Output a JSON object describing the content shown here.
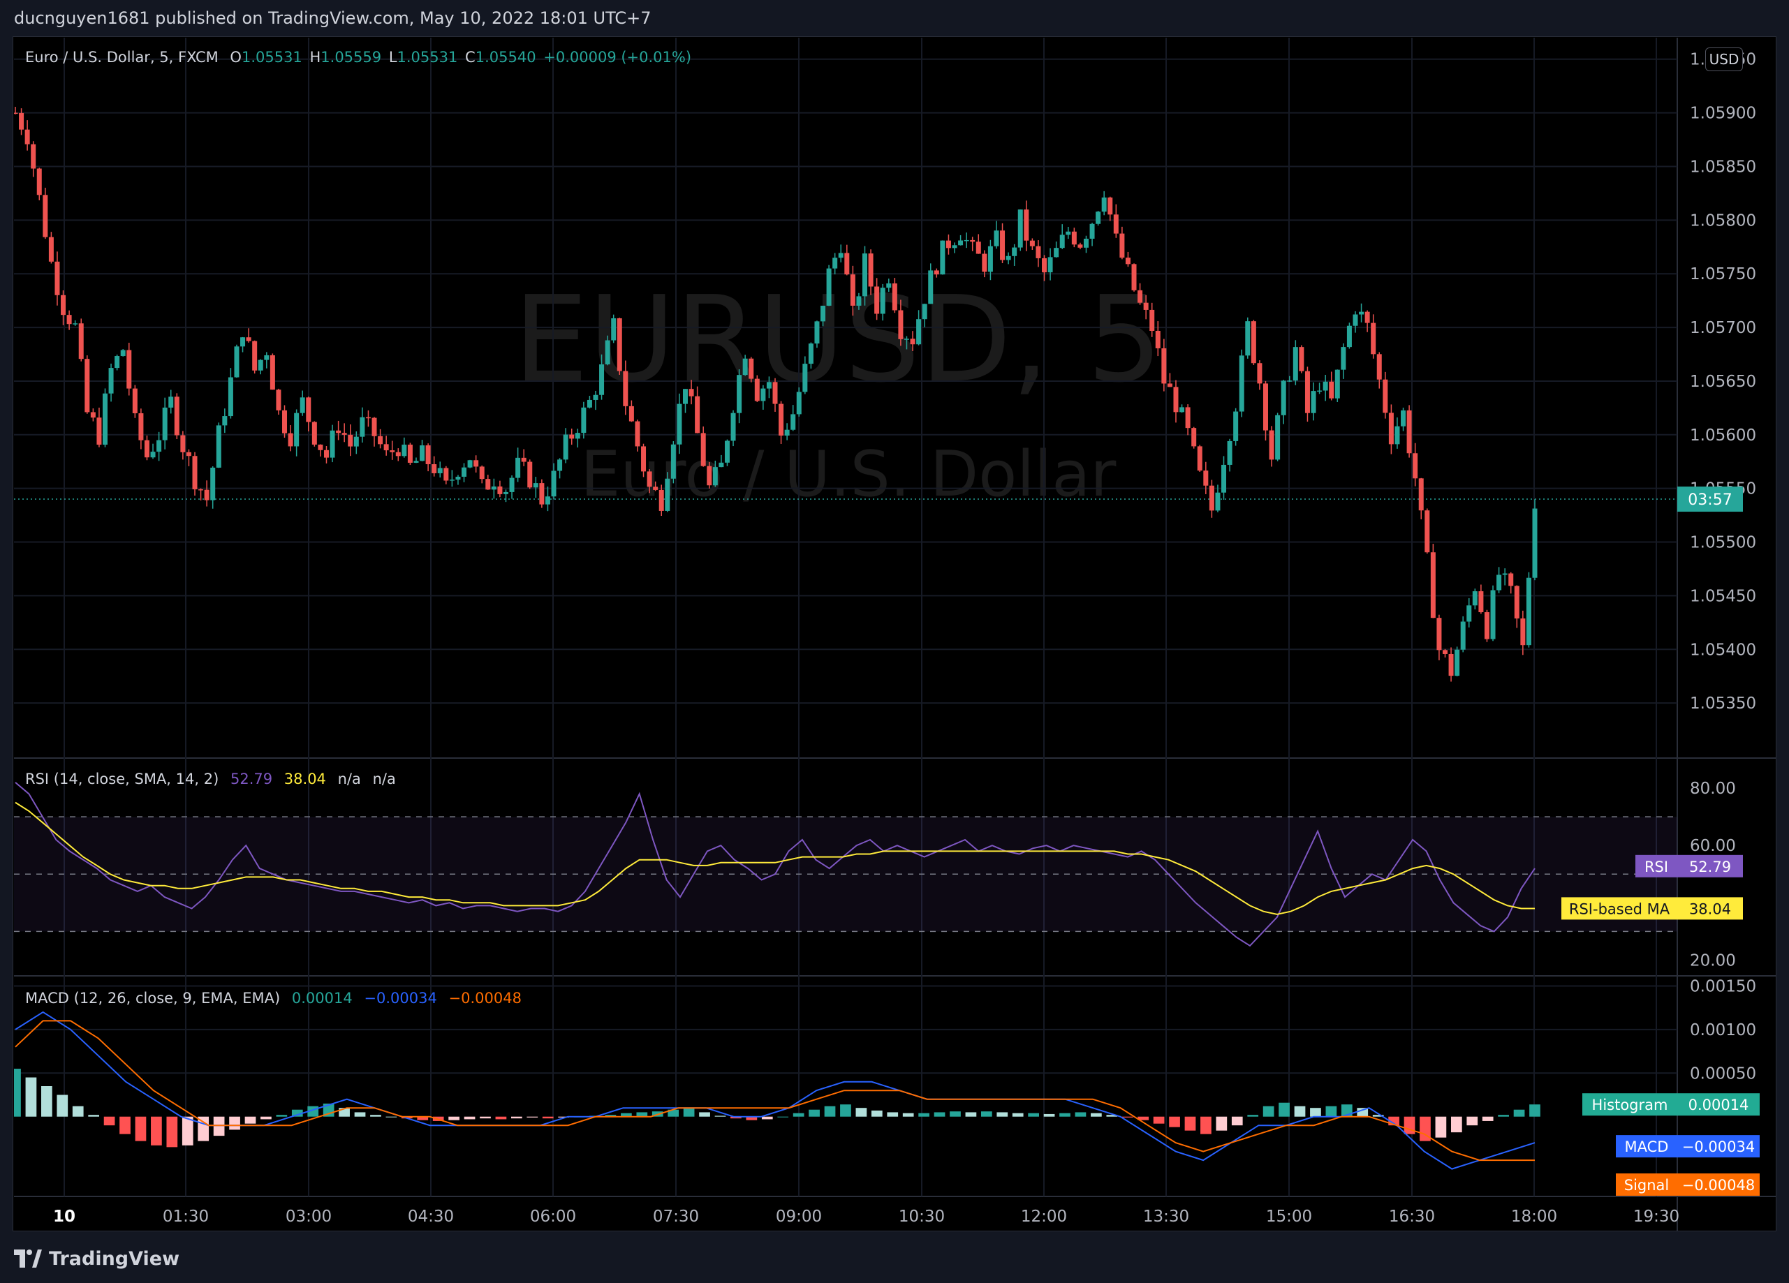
{
  "header": {
    "published_text": "ducnguyen1681 published on TradingView.com, May 10, 2022 18:01 UTC+7"
  },
  "footer": {
    "brand": "TradingView"
  },
  "main_legend": {
    "symbol": "Euro / U.S. Dollar, 5, FXCM",
    "o_label": "O",
    "o_value": "1.05531",
    "h_label": "H",
    "h_value": "1.05559",
    "l_label": "L",
    "l_value": "1.05531",
    "c_label": "C",
    "c_value": "1.05540",
    "change": "+0.00009 (+0.01%)"
  },
  "currency_button": "USD",
  "watermark": {
    "line1": "EURUSD, 5",
    "line2": "Euro / U.S. Dollar"
  },
  "countdown": "03:57",
  "rsi_legend": {
    "name": "RSI (14, close, SMA, 14, 2)",
    "rsi_value": "52.79",
    "ma_value": "38.04",
    "na1": "n/a",
    "na2": "n/a"
  },
  "rsi_tags": {
    "rsi_label": "RSI",
    "rsi_value": "52.79",
    "ma_label": "RSI-based MA",
    "ma_value": "38.04"
  },
  "macd_legend": {
    "name": "MACD (12, 26, close, 9, EMA, EMA)",
    "hist": "0.00014",
    "macd": "−0.00034",
    "signal": "−0.00048"
  },
  "macd_tags": {
    "hist_label": "Histogram",
    "hist_value": "0.00014",
    "macd_label": "MACD",
    "macd_value": "−0.00034",
    "signal_label": "Signal",
    "signal_value": "−0.00048"
  },
  "colors": {
    "up": "#26a69a",
    "down": "#ef5350",
    "rsi": "#7e57c2",
    "rsi_ma": "#ffeb3b",
    "macd": "#2962ff",
    "signal": "#ff6d00",
    "hist_up_strong": "#26a69a",
    "hist_up_weak": "#b2dfdb",
    "hist_down_strong": "#ff5252",
    "hist_down_weak": "#ffcdd2"
  },
  "chart_data": [
    {
      "type": "candlestick",
      "title": "Euro / U.S. Dollar, 5, FXCM",
      "ylim": [
        1.053,
        1.0597
      ],
      "yticks": [
        "1.05950",
        "1.05900",
        "1.05850",
        "1.05800",
        "1.05750",
        "1.05700",
        "1.05650",
        "1.05600",
        "1.05550",
        "1.05500",
        "1.05450",
        "1.05400",
        "1.05350"
      ],
      "xticks": [
        "10",
        "01:30",
        "03:00",
        "04:30",
        "06:00",
        "07:30",
        "09:00",
        "10:30",
        "12:00",
        "13:30",
        "15:00",
        "16:30",
        "18:00",
        "19:30"
      ],
      "last_close": 1.0554,
      "close_path": [
        [
          0,
          1.059
        ],
        [
          2,
          1.0588
        ],
        [
          4,
          1.0582
        ],
        [
          6,
          1.0576
        ],
        [
          8,
          1.0572
        ],
        [
          10,
          1.057
        ],
        [
          12,
          1.0562
        ],
        [
          14,
          1.056
        ],
        [
          16,
          1.0566
        ],
        [
          18,
          1.0568
        ],
        [
          20,
          1.0561
        ],
        [
          22,
          1.0558
        ],
        [
          24,
          1.056
        ],
        [
          26,
          1.0563
        ],
        [
          28,
          1.0559
        ],
        [
          30,
          1.0556
        ],
        [
          32,
          1.0554
        ],
        [
          34,
          1.056
        ],
        [
          36,
          1.0565
        ],
        [
          38,
          1.057
        ],
        [
          40,
          1.0566
        ],
        [
          42,
          1.0568
        ],
        [
          44,
          1.0562
        ],
        [
          46,
          1.056
        ],
        [
          48,
          1.0563
        ],
        [
          50,
          1.056
        ],
        [
          52,
          1.0558
        ],
        [
          54,
          1.0561
        ],
        [
          56,
          1.0559
        ],
        [
          58,
          1.0561
        ],
        [
          60,
          1.056
        ],
        [
          62,
          1.0558
        ],
        [
          64,
          1.0559
        ],
        [
          66,
          1.0557
        ],
        [
          68,
          1.0558
        ],
        [
          70,
          1.0557
        ],
        [
          72,
          1.0555
        ],
        [
          74,
          1.0557
        ],
        [
          76,
          1.0558
        ],
        [
          78,
          1.0555
        ],
        [
          80,
          1.0556
        ],
        [
          82,
          1.0555
        ],
        [
          84,
          1.0557
        ],
        [
          86,
          1.0556
        ],
        [
          88,
          1.0554
        ],
        [
          90,
          1.0556
        ],
        [
          92,
          1.0559
        ],
        [
          94,
          1.0561
        ],
        [
          96,
          1.0563
        ],
        [
          98,
          1.0566
        ],
        [
          100,
          1.057
        ],
        [
          102,
          1.0563
        ],
        [
          104,
          1.0559
        ],
        [
          106,
          1.0555
        ],
        [
          108,
          1.0554
        ],
        [
          110,
          1.056
        ],
        [
          112,
          1.0565
        ],
        [
          114,
          1.056
        ],
        [
          116,
          1.0555
        ],
        [
          118,
          1.0557
        ],
        [
          120,
          1.0563
        ],
        [
          122,
          1.0568
        ],
        [
          124,
          1.0564
        ],
        [
          126,
          1.0565
        ],
        [
          128,
          1.056
        ],
        [
          130,
          1.0562
        ],
        [
          132,
          1.0566
        ],
        [
          134,
          1.057
        ],
        [
          136,
          1.0575
        ],
        [
          138,
          1.0578
        ],
        [
          140,
          1.0571
        ],
        [
          142,
          1.0576
        ],
        [
          144,
          1.0572
        ],
        [
          146,
          1.0575
        ],
        [
          148,
          1.057
        ],
        [
          150,
          1.0569
        ],
        [
          152,
          1.0573
        ],
        [
          154,
          1.0576
        ],
        [
          156,
          1.0578
        ],
        [
          158,
          1.0579
        ],
        [
          160,
          1.0577
        ],
        [
          162,
          1.0576
        ],
        [
          164,
          1.0578
        ],
        [
          166,
          1.0576
        ],
        [
          168,
          1.058
        ],
        [
          170,
          1.0577
        ],
        [
          172,
          1.0575
        ],
        [
          174,
          1.0577
        ],
        [
          176,
          1.0579
        ],
        [
          178,
          1.0578
        ],
        [
          180,
          1.058
        ],
        [
          182,
          1.0583
        ],
        [
          184,
          1.0578
        ],
        [
          186,
          1.0575
        ],
        [
          188,
          1.0572
        ],
        [
          190,
          1.057
        ],
        [
          192,
          1.0565
        ],
        [
          194,
          1.0563
        ],
        [
          196,
          1.056
        ],
        [
          198,
          1.0556
        ],
        [
          200,
          1.0553
        ],
        [
          202,
          1.0558
        ],
        [
          204,
          1.0563
        ],
        [
          206,
          1.057
        ],
        [
          208,
          1.0565
        ],
        [
          210,
          1.0558
        ],
        [
          212,
          1.0564
        ],
        [
          214,
          1.0568
        ],
        [
          216,
          1.0562
        ],
        [
          218,
          1.0565
        ],
        [
          220,
          1.0563
        ],
        [
          222,
          1.0568
        ],
        [
          224,
          1.0572
        ],
        [
          226,
          1.057
        ],
        [
          228,
          1.0565
        ],
        [
          230,
          1.056
        ],
        [
          232,
          1.0562
        ],
        [
          234,
          1.0556
        ],
        [
          236,
          1.0548
        ],
        [
          238,
          1.054
        ],
        [
          240,
          1.0538
        ],
        [
          242,
          1.0542
        ],
        [
          244,
          1.0546
        ],
        [
          246,
          1.0542
        ],
        [
          248,
          1.0547
        ],
        [
          250,
          1.0545
        ],
        [
          252,
          1.054
        ],
        [
          254,
          1.0554
        ]
      ]
    },
    {
      "type": "line",
      "title": "RSI (14, close, SMA, 14, 2)",
      "ylim": [
        15,
        90
      ],
      "yticks": [
        "80.00",
        "60.00",
        "20.00"
      ],
      "bands": [
        70,
        50,
        30
      ],
      "series": [
        {
          "name": "RSI",
          "values": [
            82,
            78,
            70,
            62,
            58,
            55,
            52,
            48,
            46,
            44,
            46,
            42,
            40,
            38,
            42,
            48,
            55,
            60,
            52,
            50,
            48,
            47,
            46,
            45,
            44,
            44,
            43,
            42,
            41,
            40,
            41,
            39,
            40,
            38,
            39,
            39,
            38,
            37,
            38,
            38,
            37,
            39,
            44,
            52,
            60,
            68,
            78,
            62,
            48,
            42,
            50,
            58,
            60,
            55,
            52,
            48,
            50,
            58,
            62,
            55,
            52,
            56,
            60,
            62,
            58,
            60,
            58,
            56,
            58,
            60,
            62,
            58,
            60,
            58,
            57,
            59,
            60,
            58,
            60,
            59,
            58,
            57,
            56,
            58,
            55,
            50,
            45,
            40,
            36,
            32,
            28,
            25,
            30,
            35,
            45,
            55,
            65,
            52,
            42,
            46,
            50,
            48,
            55,
            62,
            58,
            48,
            40,
            36,
            32,
            30,
            35,
            45,
            52
          ],
          "color": "#7e57c2"
        },
        {
          "name": "RSI-based MA",
          "values": [
            75,
            72,
            68,
            64,
            60,
            56,
            53,
            50,
            48,
            47,
            46,
            46,
            45,
            45,
            46,
            47,
            48,
            49,
            49,
            49,
            48,
            48,
            47,
            46,
            45,
            45,
            44,
            44,
            43,
            42,
            42,
            41,
            41,
            40,
            40,
            40,
            39,
            39,
            39,
            39,
            39,
            40,
            41,
            44,
            48,
            52,
            55,
            55,
            55,
            54,
            53,
            53,
            54,
            54,
            54,
            54,
            54,
            55,
            56,
            56,
            56,
            56,
            57,
            57,
            58,
            58,
            58,
            58,
            58,
            58,
            58,
            58,
            58,
            58,
            58,
            58,
            58,
            58,
            58,
            58,
            58,
            58,
            57,
            57,
            56,
            55,
            53,
            51,
            48,
            45,
            42,
            39,
            37,
            36,
            37,
            39,
            42,
            44,
            45,
            46,
            47,
            48,
            50,
            52,
            53,
            52,
            50,
            47,
            44,
            41,
            39,
            38,
            38
          ],
          "color": "#ffeb3b"
        }
      ]
    },
    {
      "type": "bar+line",
      "title": "MACD (12, 26, close, 9, EMA, EMA)",
      "ylim": [
        -0.0009,
        0.0016
      ],
      "yticks": [
        "0.00150",
        "0.00100",
        "0.00050"
      ],
      "histogram": [
        0.00055,
        0.00045,
        0.00035,
        0.00025,
        0.00012,
        2e-05,
        -0.0001,
        -0.0002,
        -0.00028,
        -0.00033,
        -0.00035,
        -0.00033,
        -0.00028,
        -0.00022,
        -0.00015,
        -8e-05,
        -3e-05,
        2e-05,
        8e-05,
        0.00012,
        0.00015,
        0.0001,
        5e-05,
        2e-05,
        0,
        -2e-05,
        -4e-05,
        -5e-05,
        -4e-05,
        -3e-05,
        -2e-05,
        -3e-05,
        -2e-05,
        -1e-05,
        -2e-05,
        -1e-05,
        0,
        1e-05,
        2e-05,
        4e-05,
        5e-05,
        6e-05,
        8e-05,
        0.0001,
        5e-05,
        1e-05,
        -2e-05,
        -4e-05,
        -3e-05,
        0,
        4e-05,
        8e-05,
        0.00012,
        0.00014,
        0.0001,
        7e-05,
        5e-05,
        4e-05,
        4e-05,
        5e-05,
        6e-05,
        5e-05,
        6e-05,
        5e-05,
        4e-05,
        4e-05,
        3e-05,
        4e-05,
        5e-05,
        4e-05,
        2e-05,
        -1e-05,
        -4e-05,
        -8e-05,
        -0.00012,
        -0.00016,
        -0.0002,
        -0.00016,
        -0.0001,
        2e-05,
        0.00012,
        0.00016,
        0.00012,
        0.0001,
        0.00012,
        0.00014,
        0.0001,
        2e-05,
        -0.0001,
        -0.0002,
        -0.00028,
        -0.00024,
        -0.00018,
        -0.0001,
        -5e-05,
        2e-05,
        8e-05,
        0.00014
      ],
      "series": [
        {
          "name": "MACD",
          "values": [
            0.001,
            0.0012,
            0.001,
            0.0007,
            0.0004,
            0.0002,
            0.0,
            -0.0001,
            -0.0001,
            -0.0001,
            0.0,
            0.0001,
            0.0002,
            0.0001,
            0.0,
            -0.0001,
            -0.0001,
            -0.0001,
            -0.0001,
            -0.0001,
            0.0,
            0.0,
            0.0001,
            0.0001,
            0.0001,
            0.0001,
            0.0,
            0.0,
            0.0001,
            0.0003,
            0.0004,
            0.0004,
            0.0003,
            0.0002,
            0.0002,
            0.0002,
            0.0002,
            0.0002,
            0.0002,
            0.0001,
            0.0,
            -0.0002,
            -0.0004,
            -0.0005,
            -0.0003,
            -0.0001,
            -0.0001,
            0.0,
            0.0,
            0.0001,
            -0.0001,
            -0.0004,
            -0.0006,
            -0.0005,
            -0.0004,
            -0.0003
          ]
        },
        {
          "name": "Signal",
          "values": [
            0.0008,
            0.0011,
            0.0011,
            0.0009,
            0.0006,
            0.0003,
            0.0001,
            -0.0001,
            -0.0001,
            -0.0001,
            -0.0001,
            0.0,
            0.0001,
            0.0001,
            0.0,
            0.0,
            -0.0001,
            -0.0001,
            -0.0001,
            -0.0001,
            -0.0001,
            0.0,
            0.0,
            0.0,
            0.0001,
            0.0001,
            0.0001,
            0.0001,
            0.0001,
            0.0002,
            0.0003,
            0.0003,
            0.0003,
            0.0002,
            0.0002,
            0.0002,
            0.0002,
            0.0002,
            0.0002,
            0.0002,
            0.0001,
            -0.0001,
            -0.0003,
            -0.0004,
            -0.0003,
            -0.0002,
            -0.0001,
            -0.0001,
            0.0,
            0.0,
            -0.0001,
            -0.0002,
            -0.0004,
            -0.0005,
            -0.0005,
            -0.0005
          ]
        }
      ]
    }
  ]
}
